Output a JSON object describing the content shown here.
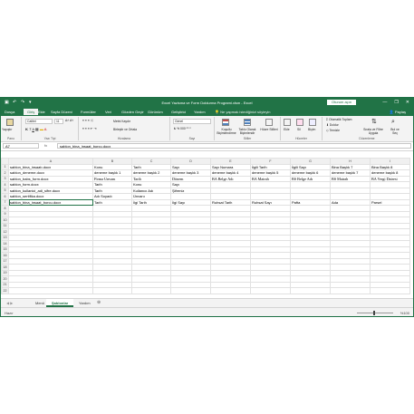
{
  "titlebar": {
    "title": "Excel Yazisma ve Form Doldurma Programi.xlsm  -  Excel",
    "signin": "Oturum açın",
    "minimize": "—",
    "restore": "❐",
    "close": "✕"
  },
  "tabs": [
    "Dosya",
    "Giriş",
    "Ekle",
    "Sayfa Düzeni",
    "Formüller",
    "Veri",
    "Gözden Geçir",
    "Görünüm",
    "Geliştirici",
    "Yardım"
  ],
  "tell_me": "Ne yapmak istediğinizi söyleyin",
  "share": "Paylaş",
  "ribbon": {
    "paste": "Yapıştır",
    "font_name": "Calibri",
    "font_size": "11",
    "wrap_text": "Metni Kaydır",
    "merge_center": "Birleştir ve Ortala",
    "number_format": "Genel",
    "cond_format": "Koşullu Biçimlendirme",
    "format_table": "Tablo Olarak Biçimlendir",
    "cell_styles": "Hücre Stilleri",
    "insert": "Ekle",
    "delete": "Sil",
    "format": "Biçim",
    "autosum": "Otomatik Toplam",
    "fill": "Doldur",
    "clear": "Temizle",
    "sort_filter": "Sırala ve Filtre Uygula",
    "find_select": "Bul ve Seç",
    "groups": [
      "Pano",
      "Yazı Tipi",
      "Hizalama",
      "Sayı",
      "Stiller",
      "Hücreler",
      "Düzenleme"
    ]
  },
  "formula_bar": {
    "name_box": "A7",
    "fx": "fx",
    "formula": "sablon_bina_insaat_borcu.docx"
  },
  "columns": [
    "A",
    "B",
    "C",
    "D",
    "E",
    "F",
    "G",
    "H",
    "I"
  ],
  "rows": [
    [
      "sablon_bina_insaatı.docx",
      "Konu",
      "Tarih",
      "Sayı",
      "Sayı Numara",
      "İlgili Tarih",
      "İlgili Sayı",
      "Bina Başlık 7",
      "Bina Başlık 8"
    ],
    [
      "sablon_deneme.docx",
      "deneme başlık 1",
      "deneme başlık 2",
      "deneme başlık 3",
      "deneme başlık 4",
      "deneme başlık 5",
      "deneme başlık 6",
      "deneme başlık 7",
      "deneme başlık 8"
    ],
    [
      "sablon_babs_form.docx",
      "Firma Unvanı",
      "Tarih",
      "Dönem",
      "BA Belge Adı",
      "BA Matrah",
      "BS Belge Adı",
      "BS Matrah",
      "BA Vergi Dairesi"
    ],
    [
      "sablon_form.docx",
      "Tarih",
      "Konu",
      "Sayı",
      "",
      "",
      "",
      "",
      ""
    ],
    [
      "sablon_kullanici_adi_sifre.docx",
      "Tarih",
      "Kullanıcı Adı",
      "Şifreniz",
      "",
      "",
      "",
      "",
      ""
    ],
    [
      "sablon_sertifika.docx",
      "Adı Soyadı",
      "Ünvanı",
      "",
      "",
      "",
      "",
      "",
      ""
    ],
    [
      "sablon_bina_insaat_borcu.docx",
      "Tarih",
      "İlgi Tarih",
      "İlgi Sayı",
      "Ruhsat Tarih",
      "Ruhsat Sayı",
      "Pafta",
      "Ada",
      "Parsel"
    ]
  ],
  "serif_row_index": 2,
  "total_rows": 22,
  "sheets": [
    "Menü",
    "Şablonlar",
    "Yardım"
  ],
  "active_sheet": 1,
  "status": {
    "ready": "Hazır",
    "zoom": "%100"
  }
}
